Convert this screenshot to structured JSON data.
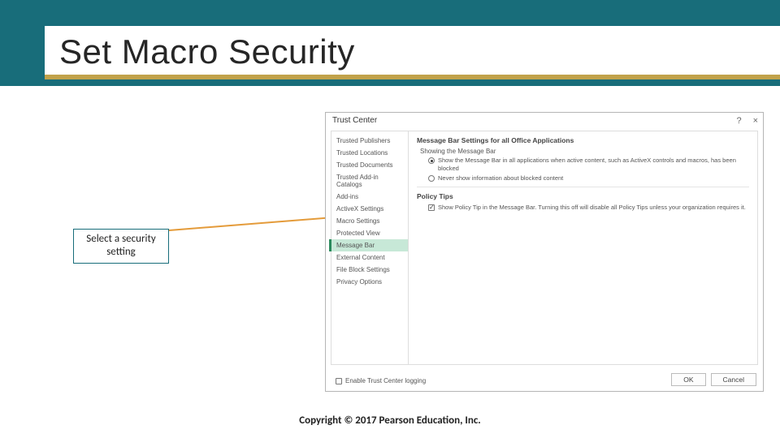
{
  "slide": {
    "title": "Set Macro Security",
    "callout": "Select a security setting",
    "copyright": "Copyright © 2017 Pearson Education, Inc."
  },
  "dialog": {
    "title": "Trust Center",
    "help_icon": "?",
    "close_icon": "×",
    "sidebar": {
      "items": [
        "Trusted Publishers",
        "Trusted Locations",
        "Trusted Documents",
        "Trusted Add-in Catalogs",
        "Add-ins",
        "ActiveX Settings",
        "Macro Settings",
        "Protected View",
        "Message Bar",
        "External Content",
        "File Block Settings",
        "Privacy Options"
      ],
      "selected_index": 8
    },
    "panel": {
      "heading": "Message Bar Settings for all Office Applications",
      "group1_label": "Showing the Message Bar",
      "radio1": "Show the Message Bar in all applications when active content, such as ActiveX controls and macros, has been blocked",
      "radio2": "Never show information about blocked content",
      "group2_label": "Policy Tips",
      "check1": "Show Policy Tip in the Message Bar. Turning this off will disable all Policy Tips unless your organization requires it."
    },
    "footer": {
      "logging": "Enable Trust Center logging",
      "ok": "OK",
      "cancel": "Cancel"
    }
  }
}
